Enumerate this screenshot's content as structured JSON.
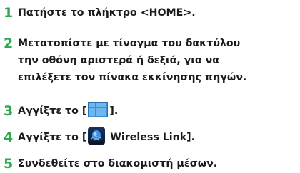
{
  "colors": {
    "step_number": "#2fa84f",
    "text": "#1a1a1a",
    "grid_icon": "#3a8fd6"
  },
  "steps": [
    {
      "number": "1",
      "lines": [
        "Πατήστε το πλήκτρο <HOME>."
      ]
    },
    {
      "number": "2",
      "lines": [
        "Μετατοπίστε με τίναγμα του δακτύλου",
        "την οθόνη αριστερά ή δεξιά, για να",
        "επιλέξετε τον πίνακα εκκίνησης πηγών."
      ]
    },
    {
      "number": "3",
      "prefix": "Αγγίξτε το [",
      "icon": "grid-menu-icon",
      "suffix": "]."
    },
    {
      "number": "4",
      "prefix": "Αγγίξτε το [",
      "icon": "wireless-link-icon",
      "icon_caption": "Wireless Link",
      "suffix": " Wireless Link]."
    },
    {
      "number": "5",
      "lines": [
        "Συνδεθείτε στο διακομιστή μέσων."
      ]
    }
  ]
}
